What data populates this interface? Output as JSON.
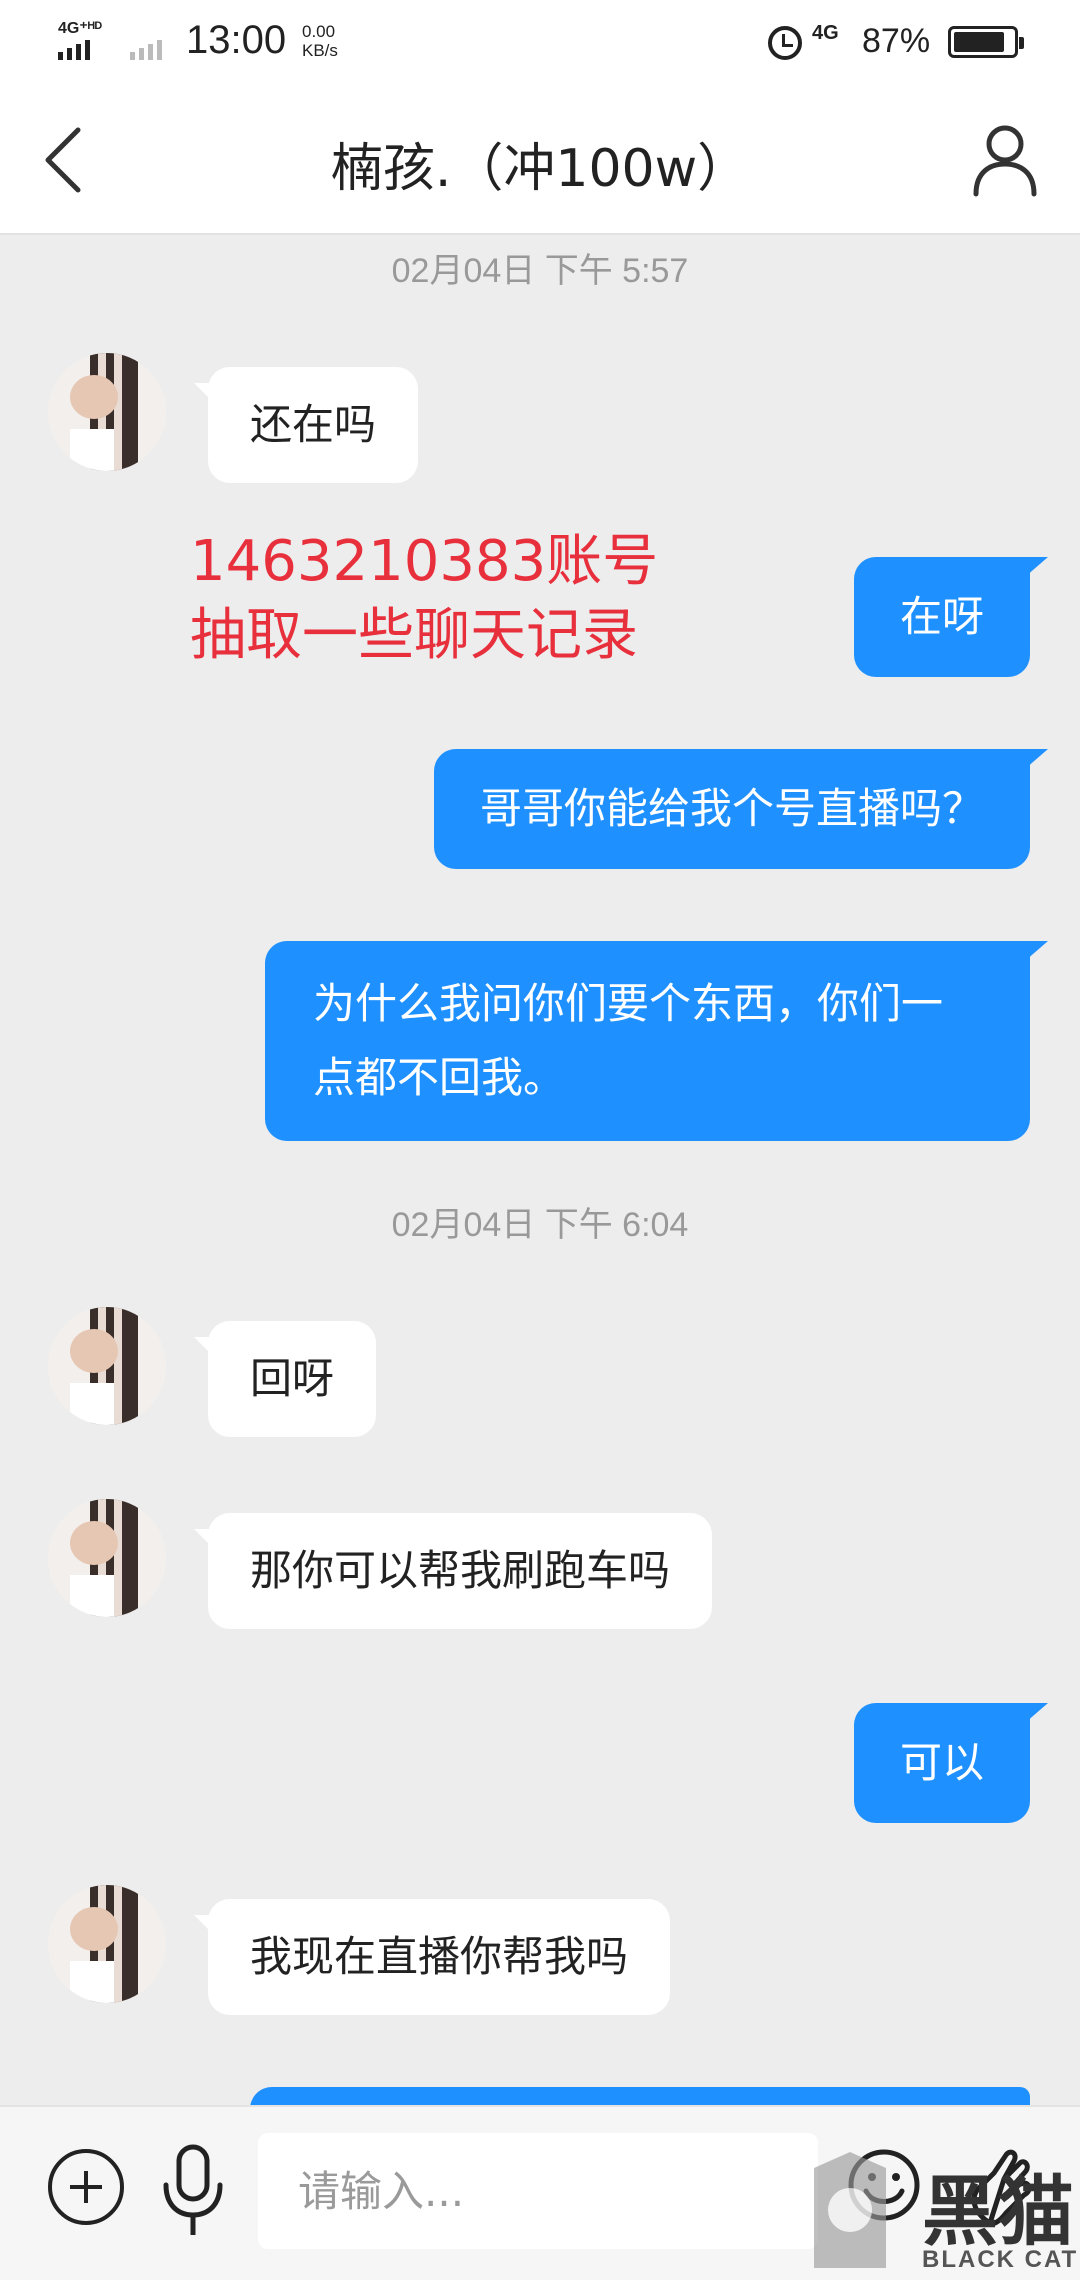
{
  "status_bar": {
    "network_left": "4G⁺ᴴᴰ",
    "time": "13:00",
    "speed_value": "0.00",
    "speed_unit": "KB/s",
    "network_right": "4G",
    "battery_percent": "87%",
    "battery_level": 0.87
  },
  "header": {
    "title": "楠孩.（冲100w）",
    "back_icon": "chevron-left-icon",
    "profile_icon": "person-icon"
  },
  "chat": {
    "timestamps": [
      "02月04日 下午 5:57",
      "02月04日 下午 6:04"
    ],
    "messages": [
      {
        "side": "left",
        "text": "还在吗"
      },
      {
        "side": "right",
        "text": "在呀"
      },
      {
        "side": "right",
        "text": "哥哥你能给我个号直播吗？"
      },
      {
        "side": "right",
        "text": "为什么我问你们要个东西，你们一点都不回我。"
      },
      {
        "side": "left",
        "text": "回呀"
      },
      {
        "side": "left",
        "text": "那你可以帮我刷跑车吗"
      },
      {
        "side": "right",
        "text": "可以"
      },
      {
        "side": "left",
        "text": "我现在直播你帮我吗"
      }
    ],
    "overlay_note": {
      "line1": "1463210383账号",
      "line2": "抽取一些聊天记录",
      "color": "#e8303d"
    },
    "accent_color": "#1e90ff"
  },
  "input_bar": {
    "placeholder": "请输入...",
    "plus_icon": "plus-circle-icon",
    "mic_icon": "microphone-icon",
    "emoji_icon": "smiley-icon",
    "gesture_icon": "hand-gesture-icon"
  },
  "watermark": {
    "cn": "黑猫",
    "en": "BLACK CAT"
  }
}
